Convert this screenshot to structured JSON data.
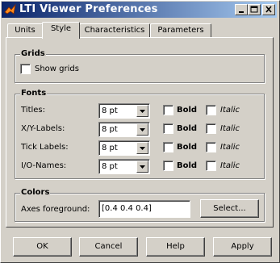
{
  "window": {
    "title": "LTI Viewer Preferences",
    "colors": {
      "titlebar_start": "#0a246a",
      "titlebar_end": "#a6caf0",
      "face": "#d4d0c8"
    }
  },
  "tabs": [
    {
      "label": "Units"
    },
    {
      "label": "Style"
    },
    {
      "label": "Characteristics"
    },
    {
      "label": "Parameters"
    }
  ],
  "active_tab": "Style",
  "grids": {
    "title": "Grids",
    "show_grids_label": "Show grids",
    "show_grids_checked": false
  },
  "fonts": {
    "title": "Fonts",
    "bold_label": "Bold",
    "italic_label": "Italic",
    "rows": [
      {
        "label": "Titles:",
        "size": "8 pt",
        "bold": false,
        "italic": false
      },
      {
        "label": "X/Y-Labels:",
        "size": "8 pt",
        "bold": false,
        "italic": false
      },
      {
        "label": "Tick Labels:",
        "size": "8 pt",
        "bold": false,
        "italic": false
      },
      {
        "label": "I/O-Names:",
        "size": "8 pt",
        "bold": false,
        "italic": false
      }
    ]
  },
  "colors": {
    "title": "Colors",
    "axes_foreground_label": "Axes foreground:",
    "axes_foreground_value": "[0.4 0.4 0.4]",
    "select_label": "Select..."
  },
  "footer": {
    "ok_label": "OK",
    "cancel_label": "Cancel",
    "help_label": "Help",
    "apply_label": "Apply"
  }
}
